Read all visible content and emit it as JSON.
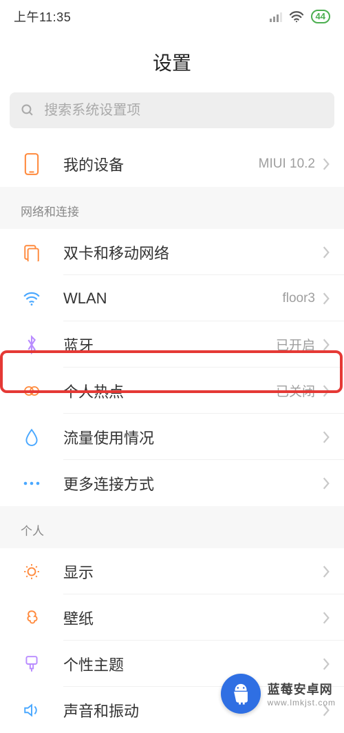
{
  "status": {
    "time": "上午11:35",
    "battery": "44"
  },
  "header": {
    "title": "设置"
  },
  "search": {
    "placeholder": "搜索系统设置项"
  },
  "top": {
    "device_label": "我的设备",
    "device_value": "MIUI 10.2"
  },
  "sections": {
    "network": {
      "title": "网络和连接",
      "sim": "双卡和移动网络",
      "wlan_label": "WLAN",
      "wlan_value": "floor3",
      "bt_label": "蓝牙",
      "bt_value": "已开启",
      "hotspot_label": "个人热点",
      "hotspot_value": "已关闭",
      "data_usage": "流量使用情况",
      "more": "更多连接方式"
    },
    "personal": {
      "title": "个人",
      "display": "显示",
      "wallpaper": "壁纸",
      "theme": "个性主题",
      "sound": "声音和振动"
    }
  },
  "watermark": {
    "line1": "蓝莓安卓网",
    "line2": "www.lmkjst.com"
  }
}
